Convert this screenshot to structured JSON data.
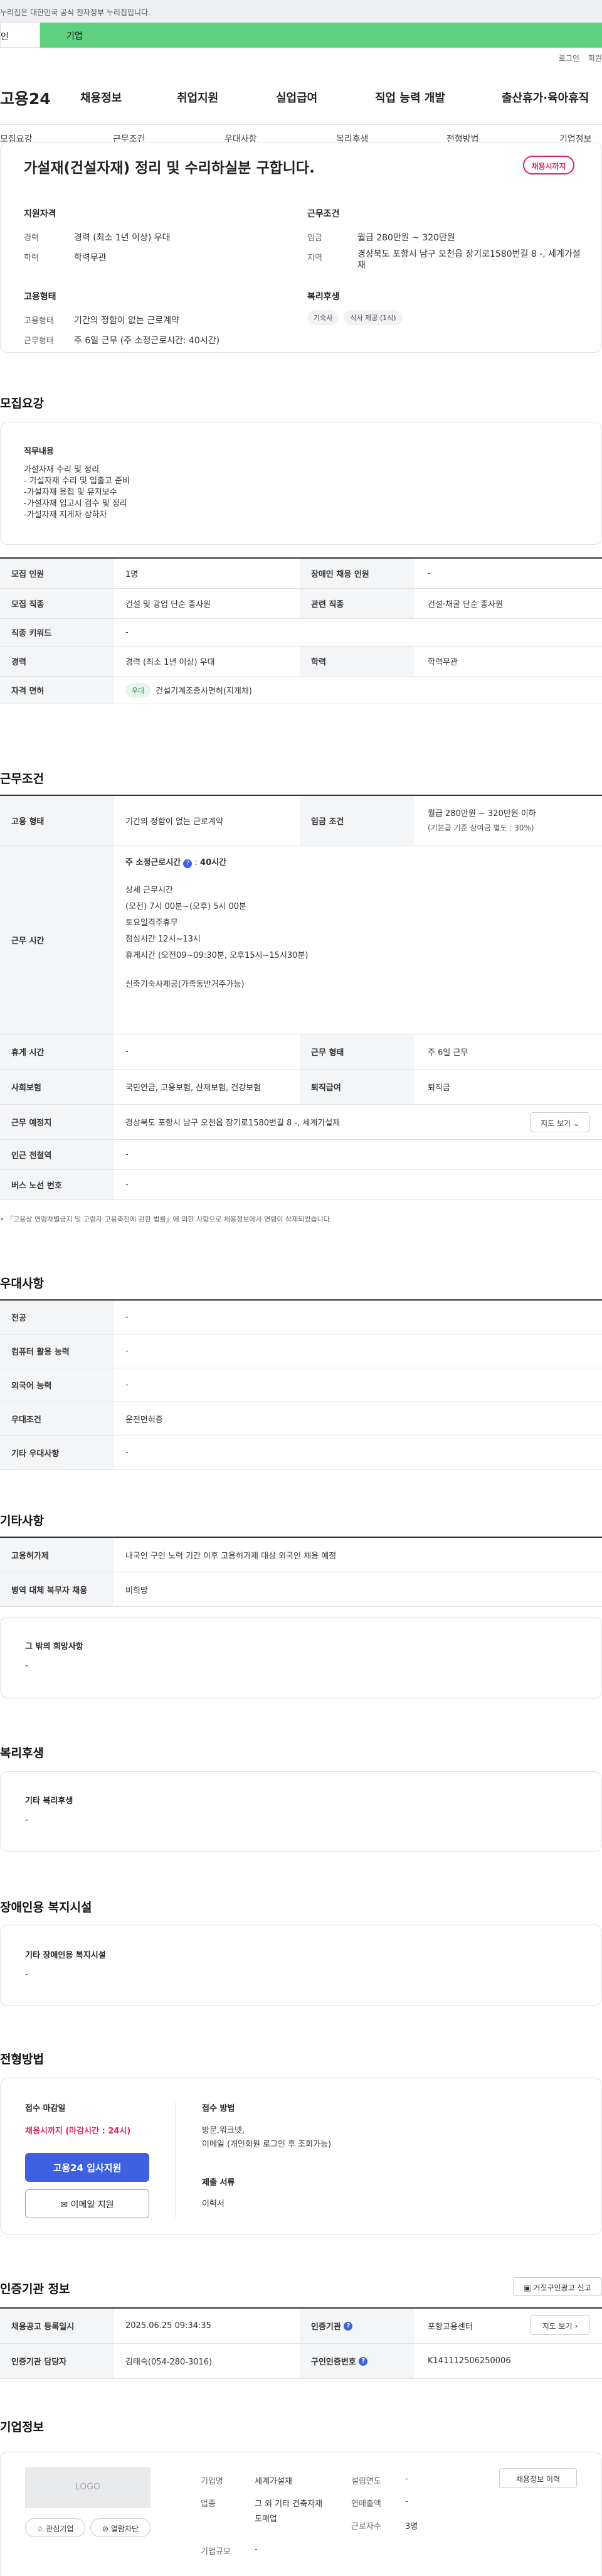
{
  "top_note": "누리집은 대한민국 공식 전자정부 누리집입니다.",
  "tabs": {
    "left": "인",
    "right": "기업"
  },
  "util": {
    "login": "로그인",
    "join": "회원"
  },
  "logo": "고용24",
  "gnb": [
    "채용정보",
    "취업지원",
    "실업급여",
    "직업 능력 개발",
    "출산휴가·육아휴직"
  ],
  "subnav": [
    "모집요강",
    "근무조건",
    "우대사항",
    "복리후생",
    "전형방법",
    "기업정보"
  ],
  "hero": {
    "title": "가설재(건설자재) 정리 및 수리하실분 구합니다.",
    "badge": "채용시까지",
    "qual_head": "지원자격",
    "qual": [
      {
        "k": "경력",
        "v": "경력 (최소 1년 이상) 우대"
      },
      {
        "k": "학력",
        "v": "학력무관"
      }
    ],
    "cond_head": "근무조건",
    "cond": [
      {
        "k": "임금",
        "v": "월급 280만원 ~ 320만원"
      },
      {
        "k": "지역",
        "v": "경상북도 포항시 남구 오천읍 장기로1580번길 8 -, 세계가설재"
      }
    ],
    "form_head": "고용형태",
    "form": [
      {
        "k": "고용형태",
        "v": "기간의 정함이 없는 근로계약"
      },
      {
        "k": "근무형태",
        "v": "주 6일 근무 (주 소정근로시간: 40시간)"
      }
    ],
    "welfare_head": "복리후생",
    "welfare": [
      "기숙사",
      "식사 제공 (1식)"
    ]
  },
  "s1": {
    "title": "모집요강",
    "duty_head": "직무내용",
    "duty": [
      "가설자재 수리 및 정리",
      "- 가설자재 수리 및 입출고 준비",
      "-가설자재 용접 및 유지보수",
      "-가설자재 입고시 검수 및 정리",
      "-가설자재 지게차 상하차"
    ],
    "rows": [
      [
        "모집 인원",
        "1명",
        "장애인 채용 인원",
        "-"
      ],
      [
        "모집 직종",
        "건설 및 광업 단순 종사원",
        "관련 직종",
        "건설·채굴 단순 종사원"
      ],
      [
        "직종 키워드",
        "-",
        "",
        ""
      ],
      [
        "경력",
        "경력 (최소 1년 이상) 우대",
        "학력",
        "학력무관"
      ]
    ],
    "license_label": "자격 면허",
    "license_tag": "우대",
    "license_val": "건설기계조종사면허(지게차)"
  },
  "s2": {
    "title": "근무조건",
    "form_k": "고용 형태",
    "form_v": "기간의 정함이 없는 근로계약",
    "wage_k": "임금 조건",
    "wage_v1": "월급 280만원 ~ 320만원 이하",
    "wage_v2": "(기본급 기준 상여금 별도 : 30%)",
    "time_k": "근무 시간",
    "time_head": "주 소정근로시간",
    "time_hours": "40시간",
    "time_lines": [
      "상세 근무시간",
      "(오전) 7시 00분~(오후) 5시 00분",
      "토요일격주휴무",
      "점심시간 12시~13시",
      "휴게시간 (오전09~09:30분, 오후15시~15시30분)",
      "",
      "신축기숙사제공(가족동반거주가능)"
    ],
    "rows": [
      [
        "휴게 시간",
        "-",
        "근무 형태",
        "주 6일 근무"
      ],
      [
        "사회보험",
        "국민연금, 고용보험, 산재보험, 건강보험",
        "퇴직급여",
        "퇴직금"
      ]
    ],
    "place_k": "근무 예정지",
    "place_v": "경상북도 포항시 남구 오천읍 장기로1580번길 8 -, 세계가설재",
    "map_btn": "지도 보기",
    "rows2": [
      [
        "인근 전철역",
        "-"
      ],
      [
        "버스 노선 번호",
        "-"
      ]
    ],
    "note": "「고용상 연령차별금지 및 고령자 고용촉진에 관한 법률」에 의한 사항으로 채용정보에서 연령이 삭제되었습니다."
  },
  "s3": {
    "title": "우대사항",
    "rows": [
      [
        "전공",
        "-"
      ],
      [
        "컴퓨터 활용 능력",
        "-"
      ],
      [
        "외국어 능력",
        "-"
      ],
      [
        "우대조건",
        "운전면허증"
      ],
      [
        "기타 우대사항",
        "-"
      ]
    ]
  },
  "s4": {
    "title": "기타사항",
    "rows": [
      [
        "고용허가제",
        "내국인 구인 노력 기간 이후 고용허가제 대상 외국인 채용 예정"
      ],
      [
        "병역 대체 복무자 채용",
        "비희망"
      ]
    ],
    "hope_head": "그 밖의 희망사항",
    "hope_val": "-"
  },
  "s5": {
    "title": "복리후생",
    "head": "기타 복리후생",
    "val": "-"
  },
  "s6": {
    "title": "장애인용 복지시설",
    "head": "기타 장애인용 복지시설",
    "val": "-"
  },
  "s7": {
    "title": "전형방법",
    "deadline_head": "접수 마감일",
    "deadline": "채용시까지 (마감시간 : 24시)",
    "apply": "고용24 입사지원",
    "email": "이메일 지원",
    "method_head": "접수 방법",
    "method": [
      "방문,워크넷,",
      "이메일 (개인회원 로그인 후 조회가능)"
    ],
    "docs_head": "제출 서류",
    "docs": "이력서"
  },
  "s8": {
    "title": "인증기관 정보",
    "report": "거짓구인광고 신고",
    "rows": [
      [
        "채용공고 등록일시",
        "2025.06.25 09:34:35",
        "인증기관",
        "포항고용센터"
      ],
      [
        "인증기관 담당자",
        "김태숙(054-280-3016)",
        "구인인증번호",
        "K141112506250006"
      ]
    ],
    "map_btn": "지도 보기"
  },
  "s9": {
    "title": "기업정보",
    "logo": "LOGO",
    "fav": "관심기업",
    "block": "열람차단",
    "k1": "기업명",
    "v1": "세계가설재",
    "k2": "업종",
    "v2": "그 외 기타 건축자재 도매업",
    "k3": "기업규모",
    "v3": "-",
    "k4": "설립연도",
    "v4": "-",
    "k5": "연매출액",
    "v5": "-",
    "k6": "근로자수",
    "v6": "3명",
    "history": "채용정보 이력"
  },
  "colors": {
    "green": "#5fcf80",
    "pink": "#e0245e",
    "blue": "#3d61e0"
  }
}
